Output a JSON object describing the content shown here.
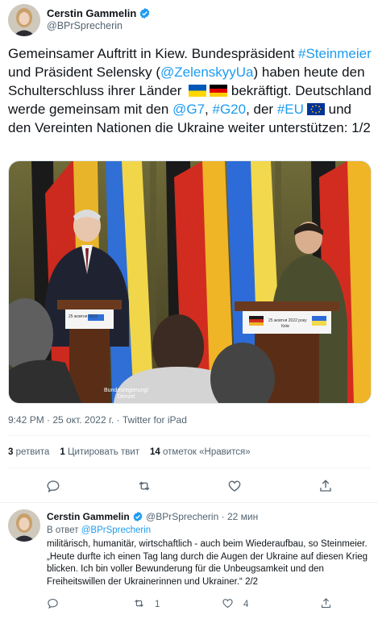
{
  "tweet": {
    "author_name": "Cerstin Gammelin",
    "author_handle": "@BPrSprecherin",
    "text_parts": {
      "p1": "Gemeinsamer Auftritt in Kiew. Bundespräsident ",
      "h1": "#Steinmeier",
      "p2": " und Präsident Selensky (",
      "h2": "@ZelenskyyUa",
      "p3": ") haben heute den Schulterschluss ihrer Länder ",
      "p4": " bekräftigt. Deutschland werde gemeinsam mit den ",
      "h3": "@G7",
      "p5": ", ",
      "h4": "#G20",
      "p6": ", der ",
      "h5": "#EU",
      "p7": " und den Vereinten Nationen die Ukraine weiter unterstützen: 1/2"
    },
    "image": {
      "caption": "Bundesregierung/\nDenzel",
      "podium_right_text_1": "25 жовтня 2022 року",
      "podium_right_text_2": "Київ",
      "podium_left_text": "25 жовтня 2022"
    },
    "timestamp": "9:42 PM · 25 окт. 2022 г. · Twitter for iPad",
    "stats": {
      "retweets_count": "3",
      "retweets_label": " ретвита",
      "quotes_count": "1",
      "quotes_label": " Цитировать твит",
      "likes_count": "14",
      "likes_label": " отметок «Нравится»"
    }
  },
  "reply": {
    "author_name": "Cerstin Gammelin",
    "author_handle": "@BPrSprecherin",
    "time": "22 мин",
    "reply_to_prefix": "В ответ ",
    "reply_to_handle": "@BPrSprecherin",
    "text": "militärisch, humanitär, wirtschaftlich - auch beim Wiederaufbau, so Steinmeier. „Heute durfte ich einen Tag lang durch die Augen der Ukraine auf diesen Krieg blicken. Ich bin voller Bewunderung für die Unbeugsamkeit und den Freiheitswillen der Ukrainerinnen und Ukrainer.“ 2/2",
    "retweet_count": "1",
    "like_count": "4"
  },
  "icons": [
    "verified-badge-icon",
    "reply-icon",
    "retweet-icon",
    "like-icon",
    "share-icon",
    "flag-ukraine-icon",
    "flag-germany-icon",
    "flag-eu-icon"
  ],
  "colors": {
    "link": "#1d9bf0",
    "secondary": "#536471",
    "text": "#0f1419",
    "divider": "#eff3f4"
  }
}
